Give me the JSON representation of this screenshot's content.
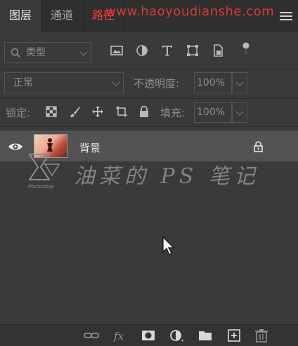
{
  "tabs": [
    {
      "label": "图层",
      "active": true
    },
    {
      "label": "通道",
      "active": false
    },
    {
      "label": "路径",
      "active": false
    }
  ],
  "watermark_url": "www.haoyoudianshe.com",
  "filter": {
    "kind_label": "类型",
    "icons": [
      "image-filter-icon",
      "adjustment-filter-icon",
      "type-filter-icon",
      "shape-filter-icon",
      "smart-object-filter-icon",
      "filter-toggle-icon"
    ]
  },
  "blend": {
    "mode": "正常",
    "opacity_label": "不透明度:",
    "opacity_value": "100%"
  },
  "lock": {
    "label": "锁定:",
    "fill_label": "填充:",
    "fill_value": "100%"
  },
  "layers": [
    {
      "name": "背景",
      "visible": true,
      "locked": true
    }
  ],
  "watermark_title": "油菜的 PS 笔记",
  "logo_text": "Photoshop",
  "colors": {
    "panel": "#3a3a3a",
    "selected_layer": "#525252",
    "tab_active_text": "#e6e6e6",
    "red_accent": "#ff3a3a"
  }
}
